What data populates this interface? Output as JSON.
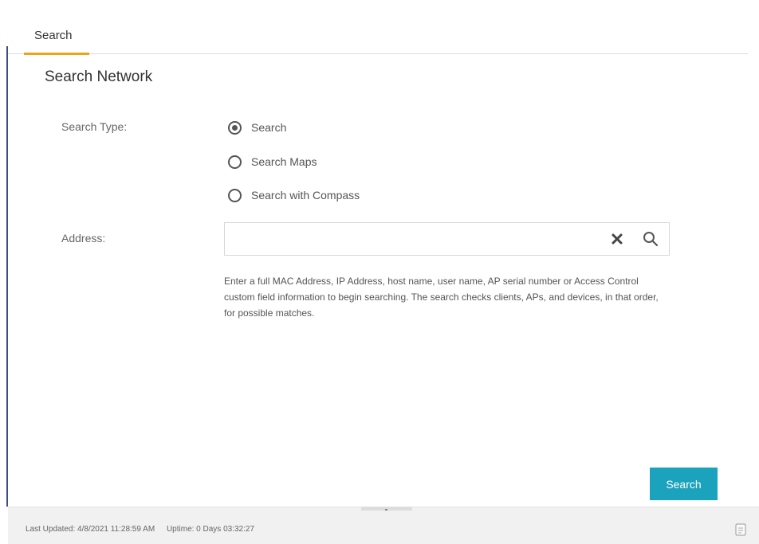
{
  "tabs": [
    {
      "label": "Search",
      "active": true
    }
  ],
  "section_title": "Search Network",
  "search_type": {
    "label": "Search Type:",
    "options": [
      {
        "label": "Search",
        "selected": true
      },
      {
        "label": "Search Maps",
        "selected": false
      },
      {
        "label": "Search with Compass",
        "selected": false
      }
    ]
  },
  "address": {
    "label": "Address:",
    "value": "",
    "clear_icon": "close-icon",
    "search_icon": "search-icon",
    "help_text": "Enter a full MAC Address, IP Address, host name, user name, AP serial number or Access Control custom field information to begin searching. The search checks clients, APs, and devices, in that order, for possible matches."
  },
  "search_button": {
    "label": "Search"
  },
  "footer": {
    "last_updated": "Last Updated: 4/8/2021 11:28:59 AM",
    "uptime": "Uptime: 0 Days 03:32:27",
    "doc_icon": "document-icon"
  },
  "colors": {
    "accent": "#1ba3bd",
    "tab_underline": "#e6a817",
    "left_rule": "#3c4f86"
  }
}
